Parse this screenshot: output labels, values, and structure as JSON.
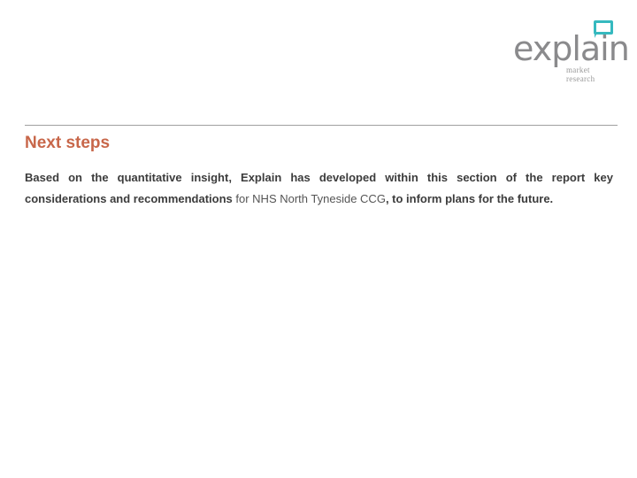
{
  "logo": {
    "wordmark": "explain",
    "tagline": "market research",
    "accent_color": "#35b9bf",
    "text_color": "#8a8a8c"
  },
  "section": {
    "title": "Next steps",
    "title_color": "#c8674a",
    "body_part1": "Based on the quantitative insight, Explain has developed within this section of the report key considerations and recommendations ",
    "body_part2": "for NHS North Tyneside CCG",
    "body_part3": ", to inform plans for the future."
  }
}
